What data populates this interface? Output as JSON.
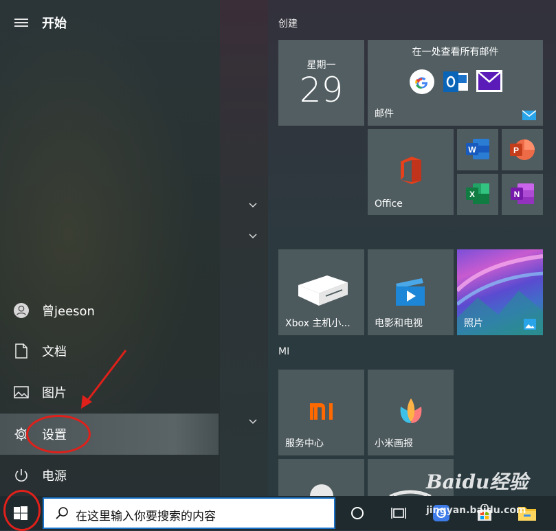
{
  "header": {
    "title": "开始"
  },
  "nav": {
    "user": "曾jeeson",
    "documents": "文档",
    "pictures": "图片",
    "settings": "设置",
    "power": "电源"
  },
  "groups": {
    "create": "创建",
    "mi": "MI"
  },
  "tiles": {
    "calendar_day": "星期一",
    "calendar_date": "29",
    "mail_header": "在一处查看所有邮件",
    "mail_label": "邮件",
    "office_label": "Office",
    "xbox_label": "Xbox 主机小...",
    "movies_label": "电影和电视",
    "photos_label": "照片",
    "service_label": "服务中心",
    "drawing_label": "小米画报"
  },
  "taskbar": {
    "search_placeholder": "在这里输入你要搜索的内容"
  },
  "watermark": {
    "logo": "Baidu经验",
    "url": "jingyan.baidu.com"
  },
  "colors": {
    "accent": "#1a73c8",
    "annotation": "#e0201a",
    "tile_bg": "#4d5a5e"
  }
}
